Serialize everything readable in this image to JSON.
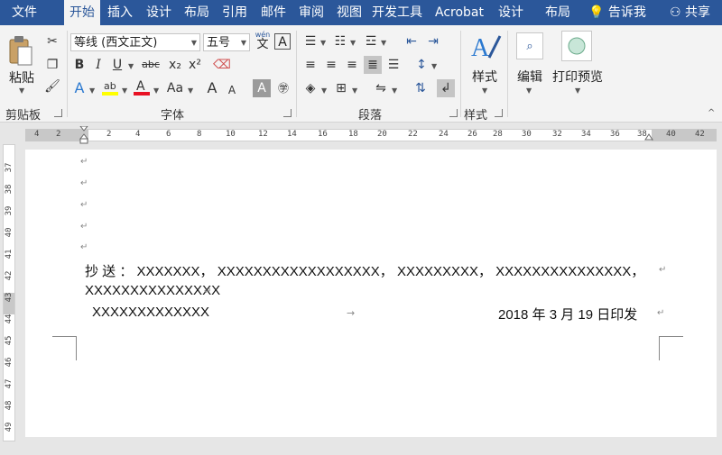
{
  "tabs": [
    "文件",
    "开始",
    "插入",
    "设计",
    "布局",
    "引用",
    "邮件",
    "审阅",
    "视图",
    "开发工具",
    "Acrobat",
    "设计",
    "布局"
  ],
  "active_tab": "开始",
  "tell_me": "告诉我",
  "share": "共享",
  "ribbon": {
    "clipboard": {
      "paste": "粘贴",
      "label": "剪贴板"
    },
    "font": {
      "font_name": "等线 (西文正文)",
      "font_size": "五号",
      "wen_top": "wén",
      "wen_bottom": "文",
      "a_box": "A",
      "bold": "B",
      "italic": "I",
      "underline": "U",
      "strike": "abc",
      "sub": "x₂",
      "sup": "x²",
      "aa": "Aa",
      "label": "字体"
    },
    "paragraph": {
      "label": "段落"
    },
    "styles": {
      "button": "样式",
      "label": "样式"
    },
    "editing": {
      "button": "编辑"
    },
    "print_preview": {
      "button": "打印预览"
    }
  },
  "ruler": {
    "h_ticks": [
      "4",
      "2",
      "2",
      "4",
      "6",
      "8",
      "10",
      "12",
      "14",
      "16",
      "18",
      "20",
      "22",
      "24",
      "26",
      "28",
      "30",
      "32",
      "34",
      "36",
      "38",
      "40",
      "42"
    ],
    "v_ticks": [
      "37",
      "38",
      "39",
      "40",
      "41",
      "42",
      "43",
      "44",
      "45",
      "46",
      "47",
      "48",
      "49"
    ]
  },
  "document": {
    "line1": "抄 送 ： XXXXXXX， XXXXXXXXXXXXXXXXXX， XXXXXXXXX， XXXXXXXXXXXXXXX，",
    "line2": "XXXXXXXXXXXXXXX",
    "line3_left": "XXXXXXXXXXXXX",
    "line3_tab": "→",
    "line3_right": "2018 年 3 月 19 日印发",
    "para_mark": "↵"
  },
  "colors": {
    "title_bar": "#2b579a",
    "ribbon_bg": "#f3f3f3",
    "highlight_yellow": "#ffff00",
    "font_color_red": "#e81123"
  }
}
